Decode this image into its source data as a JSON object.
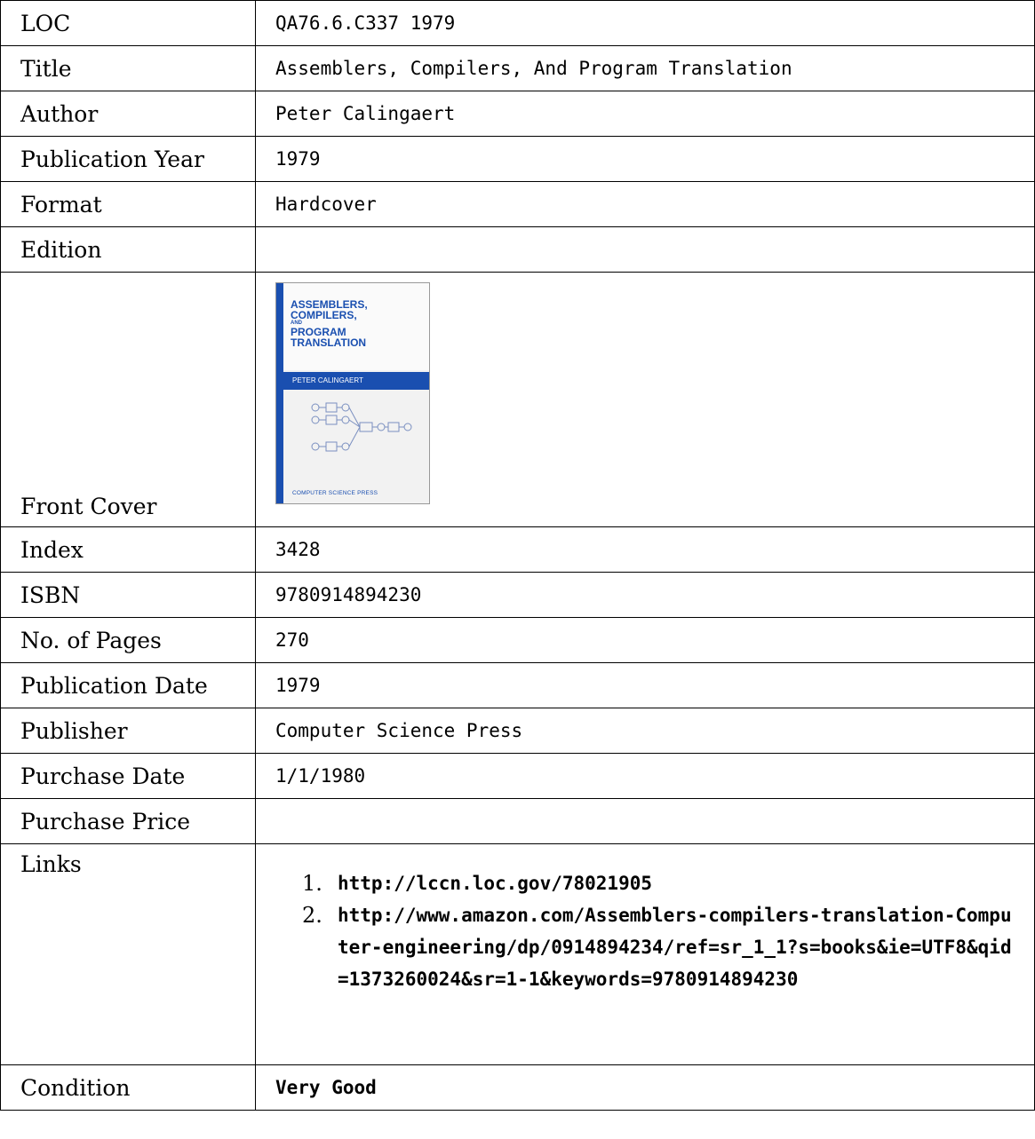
{
  "rows": {
    "loc": {
      "label": "LOC",
      "value": "QA76.6.C337 1979"
    },
    "title": {
      "label": "Title",
      "value": "Assemblers, Compilers, And Program Translation"
    },
    "author": {
      "label": "Author",
      "value": "Peter Calingaert"
    },
    "pub_year": {
      "label": "Publication Year",
      "value": "1979"
    },
    "format": {
      "label": "Format",
      "value": "Hardcover"
    },
    "edition": {
      "label": "Edition",
      "value": ""
    },
    "front_cover": {
      "label": "Front Cover"
    },
    "index": {
      "label": "Index",
      "value": "3428"
    },
    "isbn": {
      "label": "ISBN",
      "value": "9780914894230"
    },
    "pages": {
      "label": "No. of Pages",
      "value": "270"
    },
    "pub_date": {
      "label": "Publication Date",
      "value": "1979"
    },
    "publisher": {
      "label": "Publisher",
      "value": "Computer Science Press"
    },
    "purchase_date": {
      "label": "Purchase Date",
      "value": "1/1/1980"
    },
    "purchase_price": {
      "label": "Purchase Price",
      "value": ""
    },
    "links": {
      "label": "Links",
      "items": [
        "http://lccn.loc.gov/78021905",
        "http://www.amazon.com/Assemblers-compilers-translation-Computer-engineering/dp/0914894234/ref=sr_1_1?s=books&ie=UTF8&qid=1373260024&sr=1-1&keywords=9780914894230"
      ]
    },
    "condition": {
      "label": "Condition",
      "value": "Very Good"
    }
  },
  "cover": {
    "title_line1": "ASSEMBLERS,",
    "title_line2": "COMPILERS,",
    "title_and": "AND",
    "title_line3": "PROGRAM",
    "title_line4": "TRANSLATION",
    "author": "PETER CALINGAERT",
    "publisher": "COMPUTER SCIENCE PRESS",
    "accent": "#1a4fb0"
  }
}
